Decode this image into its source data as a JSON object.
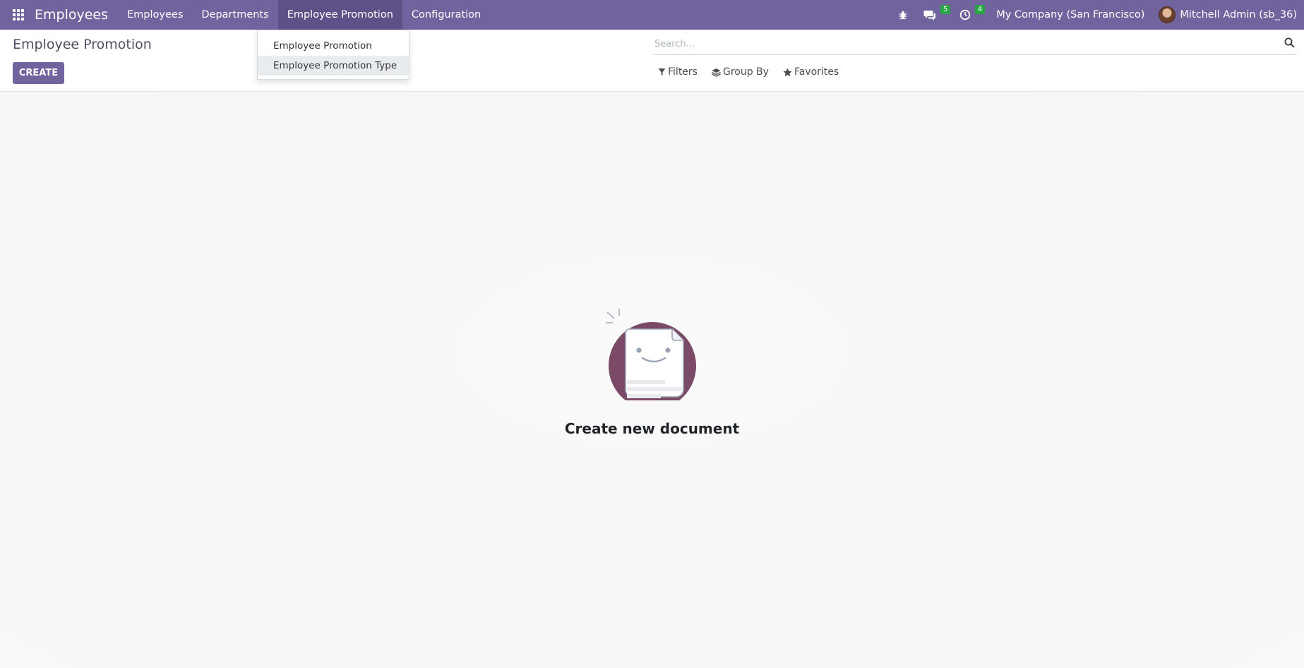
{
  "navbar": {
    "app_name": "Employees",
    "menu": [
      {
        "label": "Employees"
      },
      {
        "label": "Departments"
      },
      {
        "label": "Employee Promotion"
      },
      {
        "label": "Configuration"
      }
    ],
    "messages_badge": "5",
    "activities_badge": "4",
    "company": "My Company (San Francisco)",
    "user": "Mitchell Admin (sb_36)"
  },
  "dropdown": {
    "items": [
      {
        "label": "Employee Promotion"
      },
      {
        "label": "Employee Promotion Type"
      }
    ]
  },
  "control_panel": {
    "breadcrumb": "Employee Promotion",
    "create_label": "CREATE",
    "search_placeholder": "Search...",
    "filters_label": "Filters",
    "groupby_label": "Group By",
    "favorites_label": "Favorites"
  },
  "empty_state": {
    "title": "Create new document"
  },
  "colors": {
    "brand": "#71639e",
    "badge": "#28a745",
    "illustration_circle": "#7a4a66"
  }
}
